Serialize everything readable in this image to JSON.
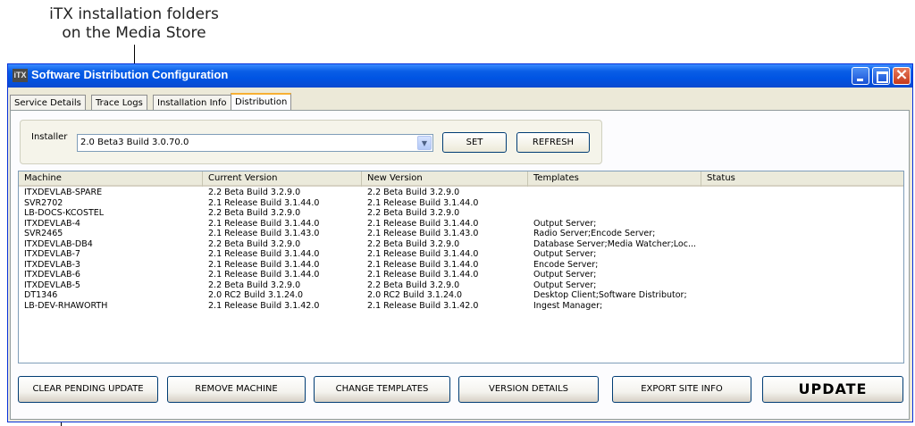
{
  "annotations": {
    "top_line1": "iTX installation folders",
    "top_line2": "on the Media Store"
  },
  "window": {
    "title": "Software Distribution Configuration",
    "icon_label": "iTX"
  },
  "tabs": [
    {
      "label": "Service Details",
      "active": false
    },
    {
      "label": "Trace Logs",
      "active": false
    },
    {
      "label": "Installation Info",
      "active": false
    },
    {
      "label": "Distribution",
      "active": true
    }
  ],
  "installer": {
    "label": "Installer",
    "selected": "2.0 Beta3 Build 3.0.70.0",
    "set_label": "SET",
    "refresh_label": "REFRESH"
  },
  "table": {
    "columns": [
      "Machine",
      "Current Version",
      "New Version",
      "Templates",
      "Status"
    ],
    "rows": [
      [
        "ITXDEVLAB-SPARE",
        "2.2 Beta Build 3.2.9.0",
        "2.2 Beta Build 3.2.9.0",
        "",
        ""
      ],
      [
        "SVR2702",
        "2.1 Release Build 3.1.44.0",
        "2.1 Release Build 3.1.44.0",
        "",
        ""
      ],
      [
        "LB-DOCS-KCOSTEL",
        "2.2 Beta Build 3.2.9.0",
        "2.2 Beta Build 3.2.9.0",
        "",
        ""
      ],
      [
        "ITXDEVLAB-4",
        "2.1 Release Build 3.1.44.0",
        "2.1 Release Build 3.1.44.0",
        "Output Server;",
        ""
      ],
      [
        "SVR2465",
        "2.1 Release Build 3.1.43.0",
        "2.1 Release Build 3.1.43.0",
        "Radio Server;Encode Server;",
        ""
      ],
      [
        "ITXDEVLAB-DB4",
        "2.2 Beta Build 3.2.9.0",
        "2.2 Beta Build 3.2.9.0",
        "Database Server;Media Watcher;Loc...",
        ""
      ],
      [
        "ITXDEVLAB-7",
        "2.1 Release Build 3.1.44.0",
        "2.1 Release Build 3.1.44.0",
        "Output Server;",
        ""
      ],
      [
        "ITXDEVLAB-3",
        "2.1 Release Build 3.1.44.0",
        "2.1 Release Build 3.1.44.0",
        "Encode Server;",
        ""
      ],
      [
        "ITXDEVLAB-6",
        "2.1 Release Build 3.1.44.0",
        "2.1 Release Build 3.1.44.0",
        "Output Server;",
        ""
      ],
      [
        "ITXDEVLAB-5",
        "2.2 Beta Build 3.2.9.0",
        "2.2 Beta Build 3.2.9.0",
        "Output Server;",
        ""
      ],
      [
        "DT1346",
        "2.0 RC2 Build 3.1.24.0",
        "2.0 RC2 Build 3.1.24.0",
        "Desktop Client;Software Distributor;",
        ""
      ],
      [
        "LB-DEV-RHAWORTH",
        "2.1 Release Build 3.1.42.0",
        "2.1 Release Build 3.1.42.0",
        "Ingest Manager;",
        ""
      ]
    ]
  },
  "buttons": {
    "clear_pending": "CLEAR PENDING UPDATE",
    "remove_machine": "REMOVE MACHINE",
    "change_templates": "CHANGE TEMPLATES",
    "version_details": "VERSION DETAILS",
    "export_site_info": "EXPORT SITE INFO",
    "update": "UPDATE"
  },
  "colors": {
    "titlebar": "#0054e3",
    "active_tab_accent": "#f7b034",
    "dialog_bg": "#ece9d8"
  }
}
